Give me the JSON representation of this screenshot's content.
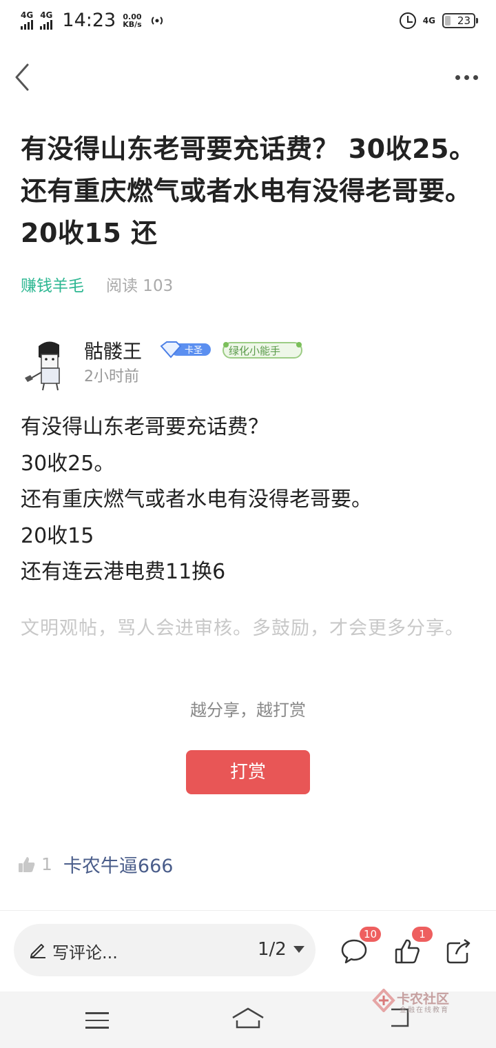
{
  "status_bar": {
    "network1": "4G",
    "network2": "4G",
    "time": "14:23",
    "speed_value": "0.00",
    "speed_unit": "KB/s",
    "network_right": "4G",
    "battery": "23"
  },
  "post": {
    "title": "有没得山东老哥要充话费？ 30收25。 还有重庆燃气或者水电有没得老哥要。 20收15 还",
    "category": "赚钱羊毛",
    "reads": "阅读 103",
    "author": "骷髅王",
    "badge_diamond": "卡圣",
    "badge_green": "绿化小能手",
    "time_ago": "2小时前",
    "lines": [
      "有没得山东老哥要充话费？",
      "30收25。",
      "还有重庆燃气或者水电有没得老哥要。",
      "20收15",
      "还有连云港电费11换6"
    ],
    "notice": "文明观帖，骂人会进审核。多鼓励，才会更多分享。",
    "reward_text": "越分享，越打赏",
    "reward_button": "打赏"
  },
  "likes": {
    "count": "1",
    "liker": "卡农牛逼666"
  },
  "bottom_bar": {
    "comment_placeholder": "写评论...",
    "page": "1/2",
    "comment_badge": "10",
    "like_badge": "1"
  },
  "watermark": {
    "name": "卡农社区",
    "tagline": "金融在线教育"
  },
  "colors": {
    "accent_green": "#2db792",
    "reward_red": "#e85656",
    "liker_blue": "#4a5d8a",
    "badge_red": "#ee5f5f"
  }
}
